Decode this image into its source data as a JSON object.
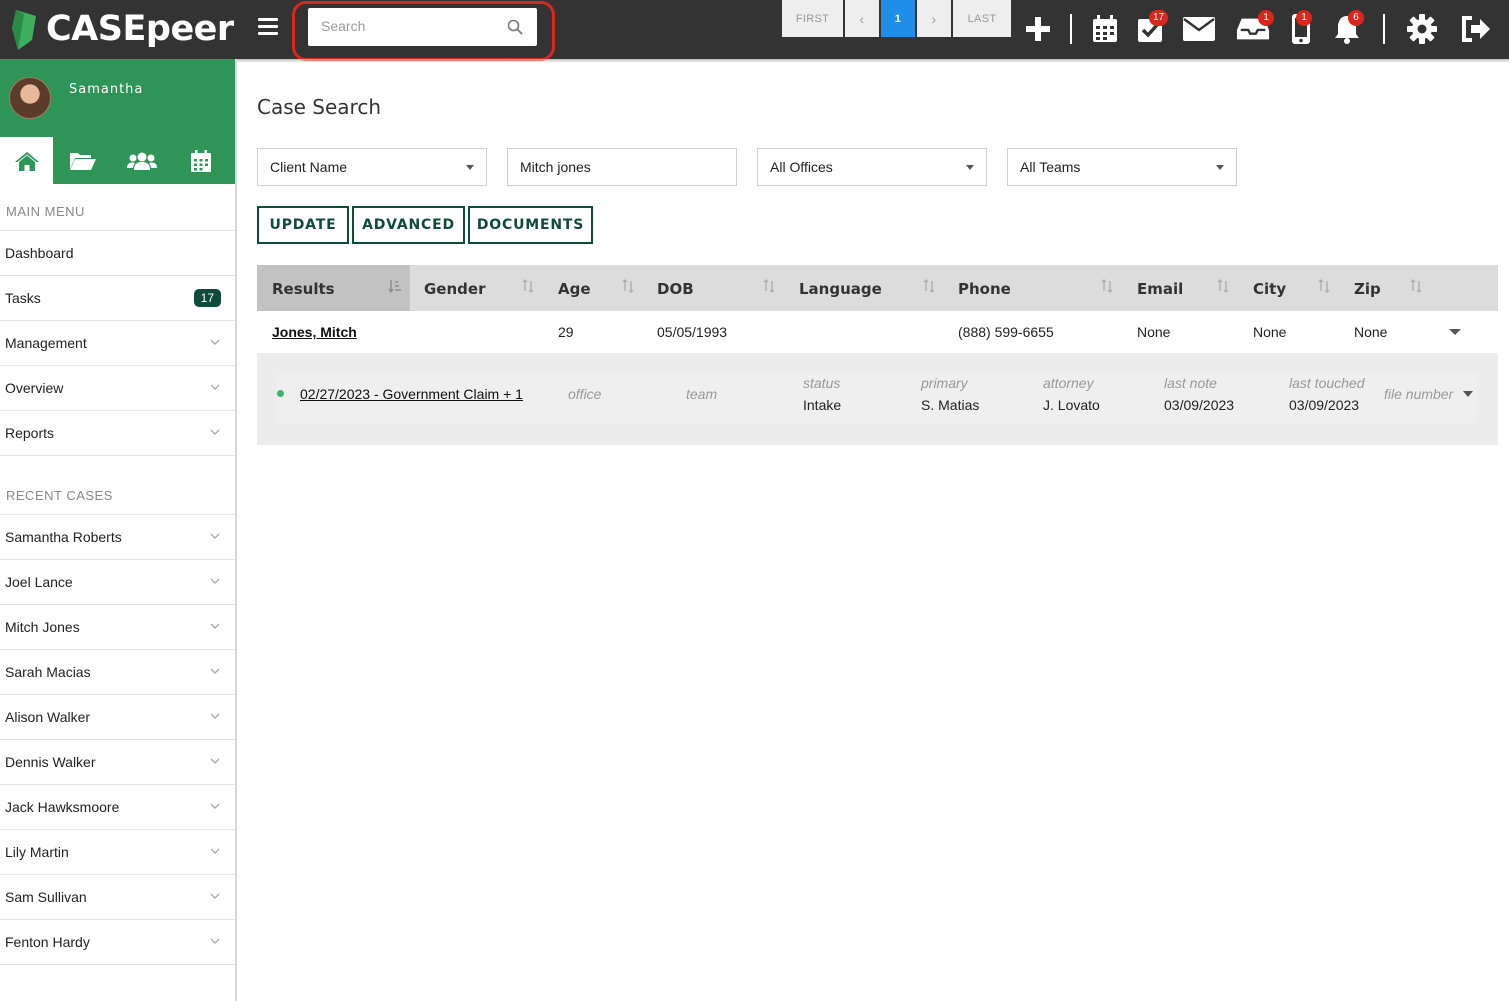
{
  "app": {
    "name": "CASEpeer"
  },
  "search": {
    "placeholder": "Search"
  },
  "topbar": {
    "badges": {
      "tasks": "17",
      "inbox": "1",
      "phone": "1",
      "notifications": "6"
    }
  },
  "user": {
    "name": "Samantha"
  },
  "sidebar": {
    "main_menu_label": "MAIN MENU",
    "main_menu": [
      {
        "label": "Dashboard"
      },
      {
        "label": "Tasks",
        "count": "17"
      },
      {
        "label": "Management"
      },
      {
        "label": "Overview"
      },
      {
        "label": "Reports"
      }
    ],
    "recent_cases_label": "RECENT CASES",
    "recent_cases": [
      {
        "label": "Samantha Roberts"
      },
      {
        "label": "Joel Lance"
      },
      {
        "label": "Mitch Jones"
      },
      {
        "label": "Sarah Macias"
      },
      {
        "label": "Alison Walker"
      },
      {
        "label": "Dennis Walker"
      },
      {
        "label": "Jack Hawksmoore"
      },
      {
        "label": "Lily Martin"
      },
      {
        "label": "Sam Sullivan"
      },
      {
        "label": "Fenton Hardy"
      }
    ]
  },
  "main": {
    "title": "Case Search",
    "filters": {
      "field": "Client Name",
      "query": "Mitch jones",
      "offices": "All Offices",
      "teams": "All Teams"
    },
    "buttons": {
      "update": "UPDATE",
      "advanced": "ADVANCED",
      "documents": "DOCUMENTS"
    },
    "columns": [
      "Results",
      "Gender",
      "Age",
      "DOB",
      "Language",
      "Phone",
      "Email",
      "City",
      "Zip"
    ],
    "result": {
      "name": "Jones, Mitch",
      "gender": "",
      "age": "29",
      "dob": "05/05/1993",
      "language": "",
      "phone": "(888) 599-6655",
      "email": "None",
      "city": "None",
      "zip": "None"
    },
    "case_detail": {
      "case": "02/27/2023 - Government Claim + 1",
      "office_label": "office",
      "team_label": "team",
      "status_label": "status",
      "status": "Intake",
      "primary_label": "primary",
      "primary": "S. Matias",
      "attorney_label": "attorney",
      "attorney": "J. Lovato",
      "last_note_label": "last note",
      "last_note": "03/09/2023",
      "last_touched_label": "last touched",
      "last_touched": "03/09/2023",
      "file_number_label": "file number"
    },
    "pagination": {
      "first": "FIRST",
      "prev": "‹",
      "current": "1",
      "next": "›",
      "last": "LAST"
    }
  }
}
